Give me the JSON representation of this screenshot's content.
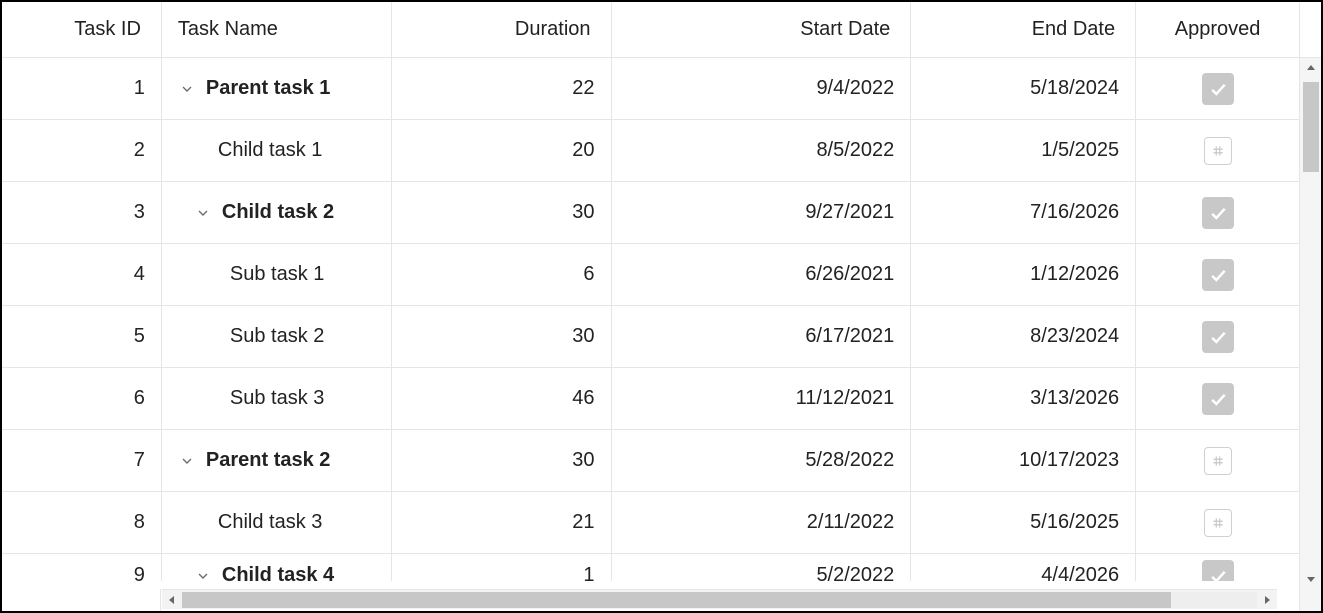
{
  "columns": {
    "task_id": "Task ID",
    "task_name": "Task Name",
    "duration": "Duration",
    "start_date": "Start Date",
    "end_date": "End Date",
    "approved": "Approved"
  },
  "rows": [
    {
      "id": "1",
      "name": "Parent task 1",
      "duration": "22",
      "start": "9/4/2022",
      "end": "5/18/2024",
      "approved": true,
      "expandable": true,
      "bold": true,
      "indent": 0
    },
    {
      "id": "2",
      "name": "Child task 1",
      "duration": "20",
      "start": "8/5/2022",
      "end": "1/5/2025",
      "approved": false,
      "expandable": false,
      "bold": false,
      "indent": 1
    },
    {
      "id": "3",
      "name": "Child task 2",
      "duration": "30",
      "start": "9/27/2021",
      "end": "7/16/2026",
      "approved": true,
      "expandable": true,
      "bold": true,
      "indent": 1
    },
    {
      "id": "4",
      "name": "Sub task 1",
      "duration": "6",
      "start": "6/26/2021",
      "end": "1/12/2026",
      "approved": true,
      "expandable": false,
      "bold": false,
      "indent": 2
    },
    {
      "id": "5",
      "name": "Sub task 2",
      "duration": "30",
      "start": "6/17/2021",
      "end": "8/23/2024",
      "approved": true,
      "expandable": false,
      "bold": false,
      "indent": 2
    },
    {
      "id": "6",
      "name": "Sub task 3",
      "duration": "46",
      "start": "11/12/2021",
      "end": "3/13/2026",
      "approved": true,
      "expandable": false,
      "bold": false,
      "indent": 2
    },
    {
      "id": "7",
      "name": "Parent task 2",
      "duration": "30",
      "start": "5/28/2022",
      "end": "10/17/2023",
      "approved": false,
      "expandable": true,
      "bold": true,
      "indent": 0
    },
    {
      "id": "8",
      "name": "Child task 3",
      "duration": "21",
      "start": "2/11/2022",
      "end": "5/16/2025",
      "approved": false,
      "expandable": false,
      "bold": false,
      "indent": 1
    },
    {
      "id": "9",
      "name": "Child task 4",
      "duration": "1",
      "start": "5/2/2022",
      "end": "4/4/2026",
      "approved": true,
      "expandable": true,
      "bold": true,
      "indent": 1
    }
  ],
  "icons": {
    "chevron_down": "chevron-down-icon",
    "check": "check-icon",
    "placeholder": "hash-icon"
  }
}
